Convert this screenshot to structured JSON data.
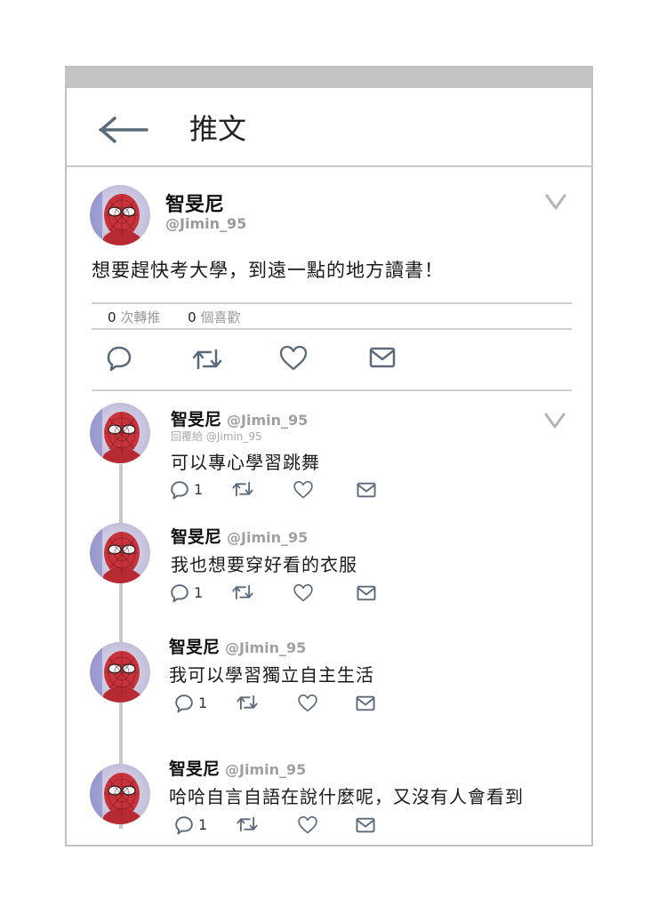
{
  "header": {
    "title": "推文",
    "back_icon": "arrow-left-icon"
  },
  "main_tweet": {
    "name": "智旻尼",
    "handle": "@Jimin_95",
    "text": "想要趕快考大學，到遠一點的地方讀書！",
    "retweet_count": "0",
    "retweet_label": "次轉推",
    "like_count": "0",
    "like_label": "個喜歡"
  },
  "replies": [
    {
      "name": "智旻尼",
      "handle": "@Jimin_95",
      "reply_to": "回覆給 @Jimin_95",
      "text": "可以專心學習跳舞",
      "reply_count": "1"
    },
    {
      "name": "智旻尼",
      "handle": "@Jimin_95",
      "text": "我也想要穿好看的衣服",
      "reply_count": "1"
    },
    {
      "name": "智旻尼",
      "handle": "@Jimin_95",
      "text": "我可以學習獨立自主生活",
      "reply_count": "1"
    },
    {
      "name": "智旻尼",
      "handle": "@Jimin_95",
      "text": "哈哈自言自語在說什麼呢，又沒有人會看到",
      "reply_count": "1"
    }
  ],
  "colors": {
    "icon_stroke": "#5a6a7a",
    "divider": "#cfcfcf",
    "handle": "#9a9a9a"
  }
}
